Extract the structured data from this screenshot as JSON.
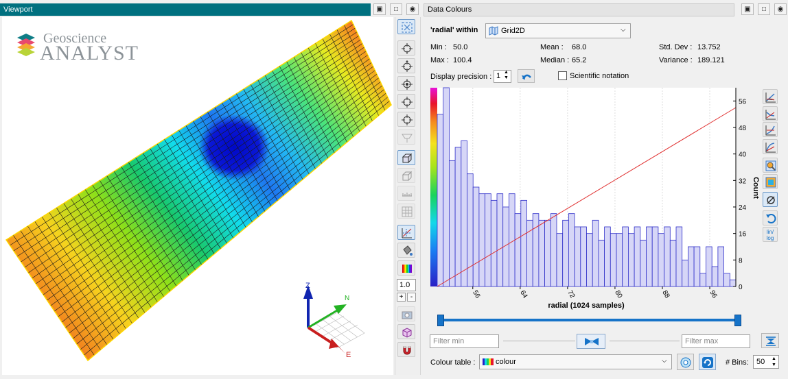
{
  "viewport": {
    "title": "Viewport",
    "logo_top": "Geoscience",
    "logo_bottom": "ANALYST",
    "axis_z": "Z",
    "axis_n": "N",
    "axis_e": "E",
    "opacity_value": "1.0",
    "plus": "+",
    "minus": "-"
  },
  "panel": {
    "title": "Data Colours",
    "data_name": "'radial' within",
    "object_select": "Grid2D",
    "stats": {
      "min_label": "Min :",
      "min_value": "50.0",
      "max_label": "Max :",
      "max_value": "100.4",
      "mean_label": "Mean :",
      "mean_value": "68.0",
      "median_label": "Median :",
      "median_value": "65.2",
      "std_label": "Std. Dev :",
      "std_value": "13.752",
      "var_label": "Variance :",
      "var_value": "189.121"
    },
    "display_precision_label": "Display precision :",
    "display_precision_value": "1",
    "scientific_label": "Scientific notation",
    "filter_min_placeholder": "Filter min",
    "filter_max_placeholder": "Filter max",
    "colour_table_label": "Colour table :",
    "colour_table_value": "colour",
    "bins_label": "# Bins:",
    "bins_value": "50"
  },
  "chart_data": {
    "type": "bar",
    "xlabel": "radial (1024 samples)",
    "ylabel": "Count",
    "xlim": [
      50,
      100.4
    ],
    "ylim": [
      0,
      60
    ],
    "x_ticks": [
      56,
      64,
      72,
      80,
      88,
      96
    ],
    "y_ticks": [
      0,
      8,
      16,
      24,
      32,
      40,
      48,
      56
    ],
    "values": [
      52,
      60,
      38,
      42,
      44,
      34,
      30,
      28,
      28,
      26,
      28,
      24,
      28,
      22,
      26,
      20,
      22,
      20,
      20,
      22,
      16,
      20,
      22,
      18,
      18,
      16,
      20,
      14,
      18,
      16,
      16,
      18,
      16,
      18,
      14,
      18,
      18,
      16,
      18,
      14,
      18,
      8,
      12,
      12,
      4,
      12,
      6,
      12,
      4,
      2
    ],
    "cumulative_line": {
      "from": [
        50,
        0
      ],
      "to": [
        100.4,
        54
      ]
    }
  },
  "colors": {
    "title_bar": "#00707f",
    "bar_fill": "#d6d6f7",
    "bar_stroke": "#2f2fc9",
    "line": "#e03030",
    "accent": "#1673c8"
  }
}
